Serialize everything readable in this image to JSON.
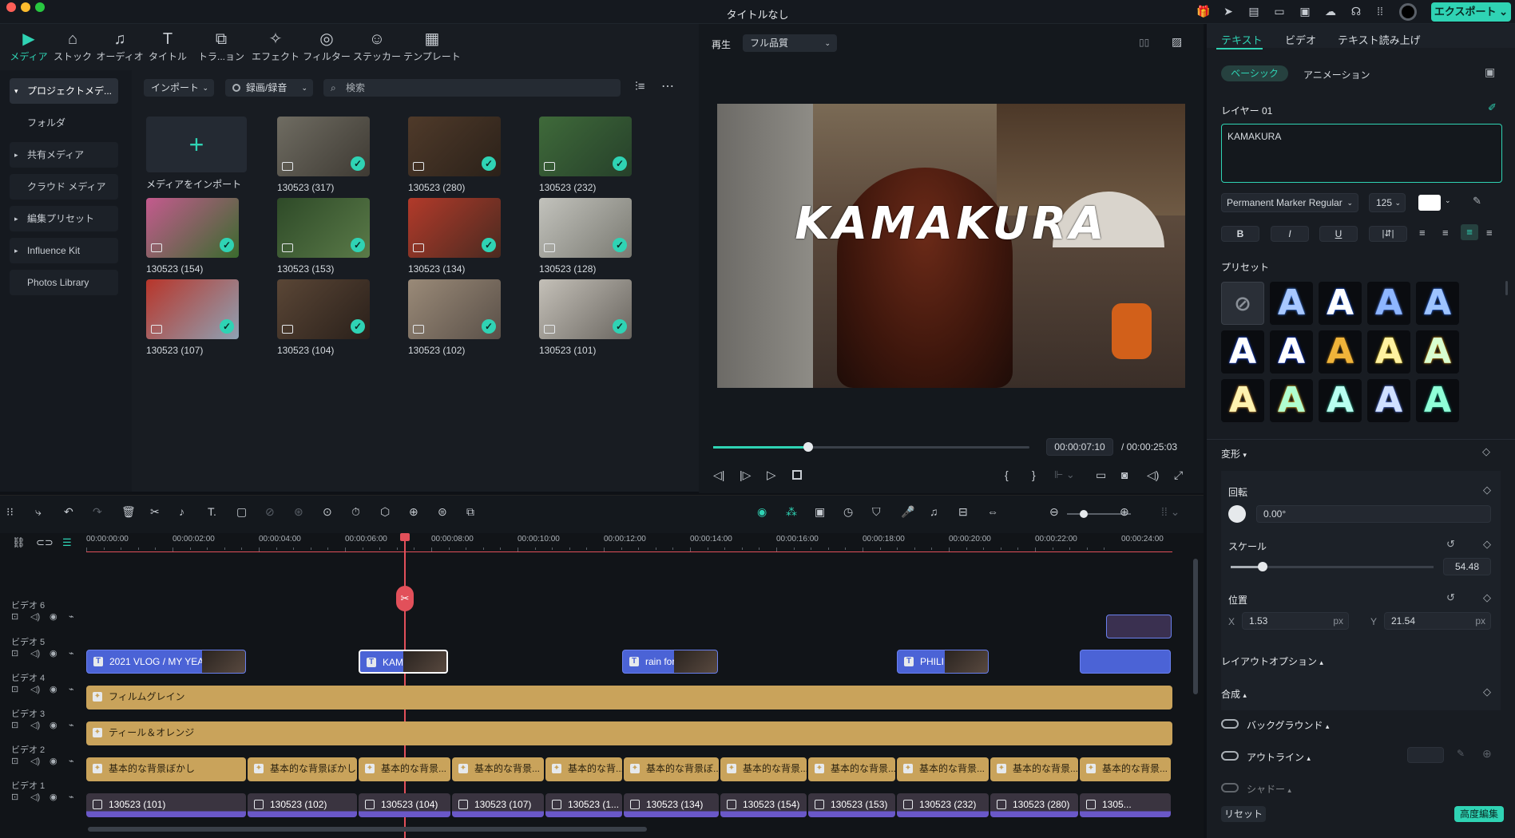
{
  "window": {
    "title": "タイトルなし",
    "export": "エクスポート"
  },
  "toolbar": [
    {
      "label": "メディア",
      "icon": "media-icon"
    },
    {
      "label": "ストック",
      "icon": "stock-icon"
    },
    {
      "label": "オーディオ",
      "icon": "music-icon"
    },
    {
      "label": "タイトル",
      "icon": "title-icon"
    },
    {
      "label": "トラ...ョン",
      "icon": "transition-icon"
    },
    {
      "label": "エフェクト",
      "icon": "effect-icon"
    },
    {
      "label": "フィルター",
      "icon": "filter-icon"
    },
    {
      "label": "ステッカー",
      "icon": "sticker-icon"
    },
    {
      "label": "テンプレート",
      "icon": "template-icon"
    }
  ],
  "leftnav": [
    "プロジェクトメデ...",
    "フォルダ",
    "共有メディア",
    "クラウド メディア",
    "編集プリセット",
    "Influence Kit",
    "Photos Library"
  ],
  "media": {
    "import": "インポート",
    "record": "録画/録音",
    "search_placeholder": "検索",
    "import_tile": "メディアをインポート",
    "items": [
      "130523 (317)",
      "130523 (280)",
      "130523 (232)",
      "130523 (154)",
      "130523 (153)",
      "130523 (134)",
      "130523 (128)",
      "130523 (107)",
      "130523 (104)",
      "130523 (102)",
      "130523 (101)"
    ]
  },
  "preview": {
    "play": "再生",
    "quality": "フル品質",
    "overlay": "KAMAKURA",
    "time_current": "00:00:07:10",
    "time_total": "/ 00:00:25:03",
    "progress": 0.3
  },
  "inspector": {
    "tabs": [
      "テキスト",
      "ビデオ",
      "テキスト読み上げ"
    ],
    "subtabs": [
      "ベーシック",
      "アニメーション"
    ],
    "layer": "レイヤー 01",
    "text": "KAMAKURA",
    "font": "Permanent Marker Regular",
    "size": "125",
    "presets": "プリセット",
    "transform": "変形",
    "rotate": "回転",
    "rotate_val": "0.00°",
    "scale": "スケール",
    "scale_val": "54.48",
    "position": "位置",
    "x_label": "X",
    "x_val": "1.53",
    "y_label": "Y",
    "y_val": "21.54",
    "unit": "px",
    "layout": "レイアウトオプション",
    "composite": "合成",
    "background": "バックグラウンド",
    "outline": "アウトライン",
    "shadow": "シャドー",
    "reset": "リセット",
    "advanced": "高度編集"
  },
  "timeline": {
    "ruler": [
      "00:00:00:00",
      "00:00:02:00",
      "00:00:04:00",
      "00:00:06:00",
      "00:00:08:00",
      "00:00:10:00",
      "00:00:12:00",
      "00:00:14:00",
      "00:00:16:00",
      "00:00:18:00",
      "00:00:20:00",
      "00:00:22:00",
      "00:00:24:00"
    ],
    "tracks": [
      "ビデオ 6",
      "ビデオ 5",
      "ビデオ 4",
      "ビデオ 3",
      "ビデオ 2",
      "ビデオ 1"
    ],
    "titles": [
      "2021 VLOG / MY YEA",
      "KAMA",
      "rain for",
      "PHILIP"
    ],
    "fx4": "フィルムグレイン",
    "fx3": "ティール＆オレンジ",
    "bg2": [
      "基本的な背景ぼかし",
      "基本的な背景ぼかし",
      "基本的な背景...",
      "基本的な背景...",
      "基本的な背...",
      "基本的な背景ぼ...",
      "基本的な背景...",
      "基本的な背景...",
      "基本的な背景...",
      "基本的な背景...",
      "基本的な背景..."
    ],
    "v1": [
      "130523 (101)",
      "130523 (102)",
      "130523 (104)",
      "130523 (107)",
      "130523 (1...",
      "130523 (134)",
      "130523 (154)",
      "130523 (153)",
      "130523 (232)",
      "130523 (280)",
      "1305..."
    ]
  }
}
